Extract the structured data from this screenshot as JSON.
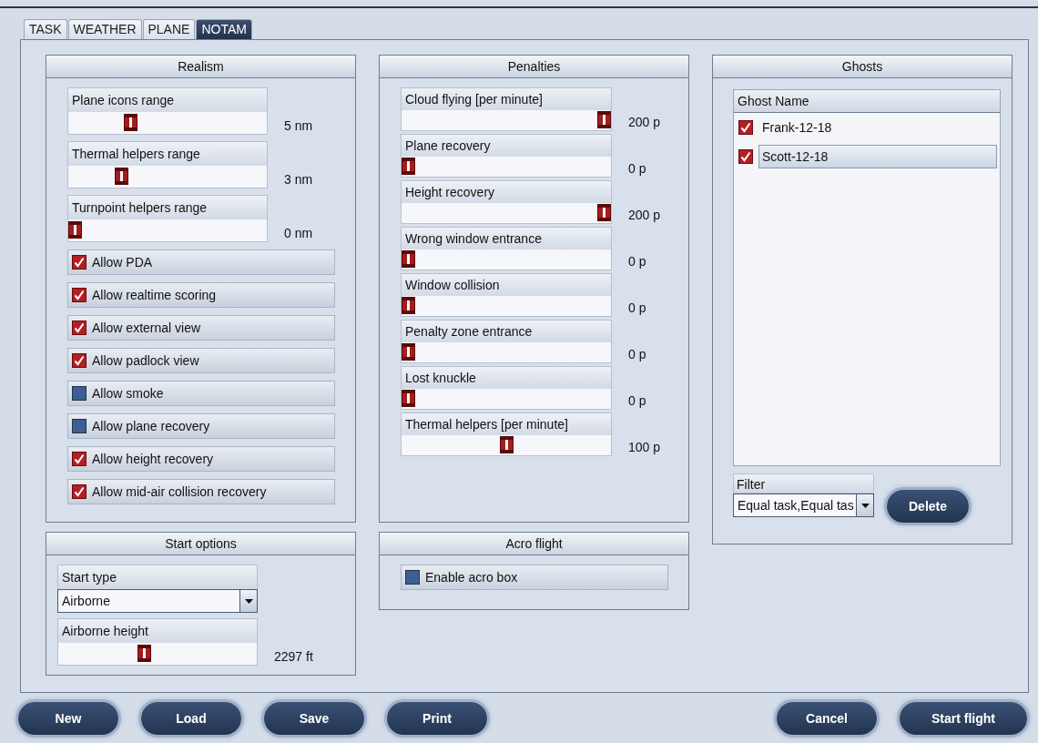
{
  "tabs": [
    {
      "label": "TASK",
      "selected": false
    },
    {
      "label": "WEATHER",
      "selected": false
    },
    {
      "label": "PLANE",
      "selected": false
    },
    {
      "label": "NOTAM",
      "selected": true
    }
  ],
  "realism": {
    "title": "Realism",
    "sliders": [
      {
        "label": "Plane icons range",
        "level": 0.3,
        "reading": "5 nm"
      },
      {
        "label": "Thermal helpers range",
        "level": 0.25,
        "reading": "3 nm"
      },
      {
        "label": "Turnpoint helpers range",
        "level": 0,
        "reading": "0 nm"
      }
    ],
    "options": [
      {
        "label": "Allow PDA",
        "checked": true
      },
      {
        "label": "Allow realtime scoring",
        "checked": true
      },
      {
        "label": "Allow external view",
        "checked": true
      },
      {
        "label": "Allow padlock view",
        "checked": true
      },
      {
        "label": "Allow smoke",
        "checked": false
      },
      {
        "label": "Allow plane recovery",
        "checked": false
      },
      {
        "label": "Allow height recovery",
        "checked": true
      },
      {
        "label": "Allow mid-air collision recovery",
        "checked": true
      }
    ]
  },
  "penalties": {
    "title": "Penalties",
    "sliders": [
      {
        "label": "Cloud flying [per minute]",
        "level": 1,
        "reading": "200 p"
      },
      {
        "label": "Plane recovery",
        "level": 0,
        "reading": "0 p"
      },
      {
        "label": "Height recovery",
        "level": 1,
        "reading": "200 p"
      },
      {
        "label": "Wrong window entrance",
        "level": 0,
        "reading": "0 p"
      },
      {
        "label": "Window collision",
        "level": 0,
        "reading": "0 p"
      },
      {
        "label": "Penalty zone entrance",
        "level": 0,
        "reading": "0 p"
      },
      {
        "label": "Lost knuckle",
        "level": 0,
        "reading": "0 p"
      },
      {
        "label": "Thermal helpers [per minute]",
        "level": 0.5,
        "reading": "100 p"
      }
    ]
  },
  "ghosts": {
    "title": "Ghosts",
    "column": "Ghost Name",
    "rows": [
      {
        "name": "Frank-12-18",
        "checked": true,
        "selected": false
      },
      {
        "name": "Scott-12-18",
        "checked": true,
        "selected": true
      }
    ],
    "filter": {
      "label": "Filter",
      "value": "Equal task,Equal tas"
    },
    "delete_button": "Delete"
  },
  "start_options": {
    "title": "Start options",
    "start_type": {
      "label": "Start type",
      "value": "Airborne"
    },
    "height_slider": {
      "label": "Airborne height",
      "level": 0.43,
      "reading": "2297 ft"
    }
  },
  "acro_flight": {
    "title": "Acro flight",
    "options": [
      {
        "label": "Enable acro box",
        "checked": false
      }
    ]
  },
  "buttons_left": [
    "New",
    "Load",
    "Save",
    "Print"
  ],
  "buttons_right": [
    "Cancel",
    "Start flight"
  ]
}
